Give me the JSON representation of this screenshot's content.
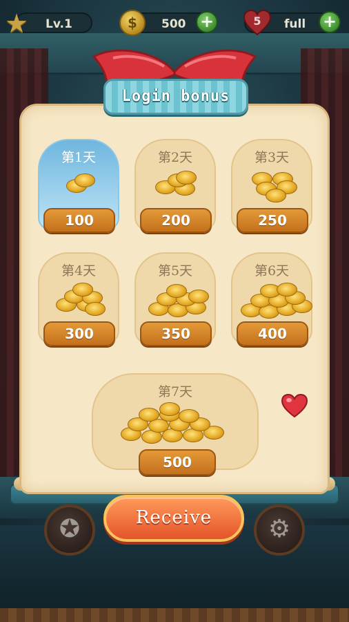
{
  "hud": {
    "level": "Lv.1",
    "coins": "500",
    "lives_count": "5",
    "lives_status": "full",
    "plus_label": "+"
  },
  "panel": {
    "title": "Login bonus",
    "receive_label": "Receive"
  },
  "days": [
    {
      "label": "第1天",
      "value": "100",
      "active": true
    },
    {
      "label": "第2天",
      "value": "200",
      "active": false
    },
    {
      "label": "第3天",
      "value": "250",
      "active": false
    },
    {
      "label": "第4天",
      "value": "300",
      "active": false
    },
    {
      "label": "第5天",
      "value": "350",
      "active": false
    },
    {
      "label": "第6天",
      "value": "400",
      "active": false
    },
    {
      "label": "第7天",
      "value": "500",
      "active": false
    }
  ],
  "icons": {
    "star": "star-icon",
    "coin": "coin-icon",
    "heart": "heart-icon",
    "plus": "plus-icon",
    "achievement": "medal-icon",
    "settings": "gear-icon"
  },
  "colors": {
    "panel": "#f6e7c6",
    "active_day": "#6fb6df",
    "value_pill": "#d9852b",
    "receive_button": "#f06d3a",
    "title_banner": "#7ccbd6"
  }
}
